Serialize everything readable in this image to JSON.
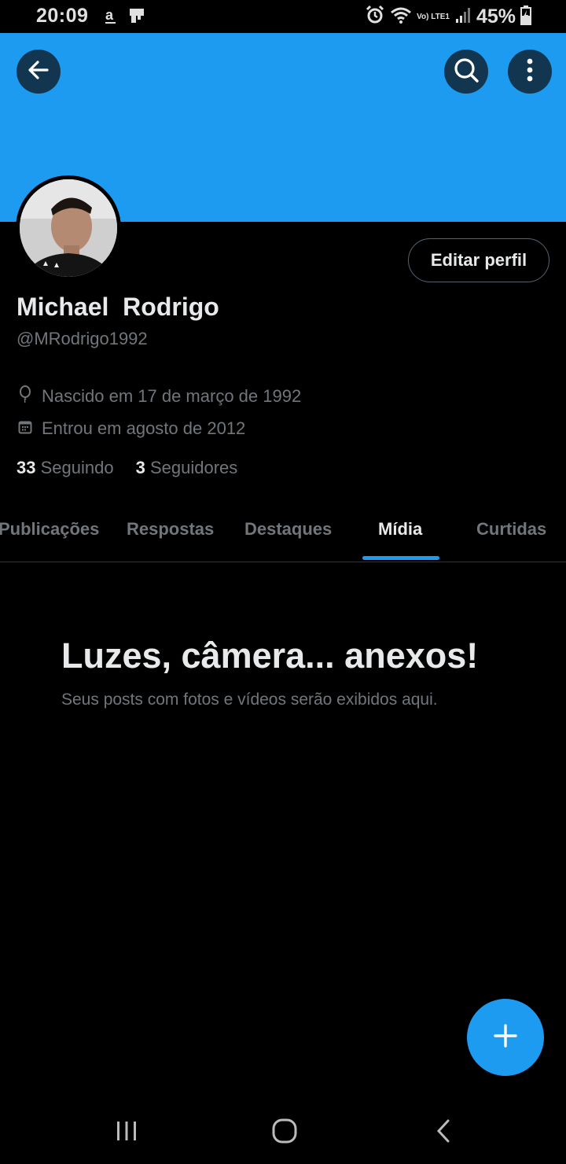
{
  "status_bar": {
    "time": "20:09",
    "battery": "45%",
    "network": "Vo) LTE1",
    "icons": [
      "amazon-icon",
      "notification-icon",
      "alarm-icon",
      "wifi-icon",
      "signal-icon",
      "battery-charging-icon"
    ]
  },
  "header": {
    "banner_color": "#1d9bf0",
    "back_icon": "arrow-left-icon",
    "search_icon": "search-icon",
    "more_icon": "more-vertical-icon"
  },
  "profile": {
    "name": "Michael  Rodrigo",
    "handle": "@MRodrigo1992",
    "edit_label": "Editar perfil",
    "born": "Nascido em 17 de março de 1992",
    "joined": "Entrou em agosto de 2012",
    "following_count": "33",
    "following_label": "Seguindo",
    "followers_count": "3",
    "followers_label": "Seguidores"
  },
  "tabs": [
    {
      "label": "Publicações",
      "active": false
    },
    {
      "label": "Respostas",
      "active": false
    },
    {
      "label": "Destaques",
      "active": false
    },
    {
      "label": "Mídia",
      "active": true
    },
    {
      "label": "Curtidas",
      "active": false
    }
  ],
  "empty_state": {
    "title": "Luzes, câmera... anexos!",
    "subtitle": "Seus posts com fotos e vídeos serão exibidos aqui."
  },
  "fab": {
    "icon": "plus-icon"
  },
  "colors": {
    "accent": "#1d9bf0",
    "background": "#000000",
    "muted_text": "#71767b",
    "text": "#e7e9ea"
  }
}
